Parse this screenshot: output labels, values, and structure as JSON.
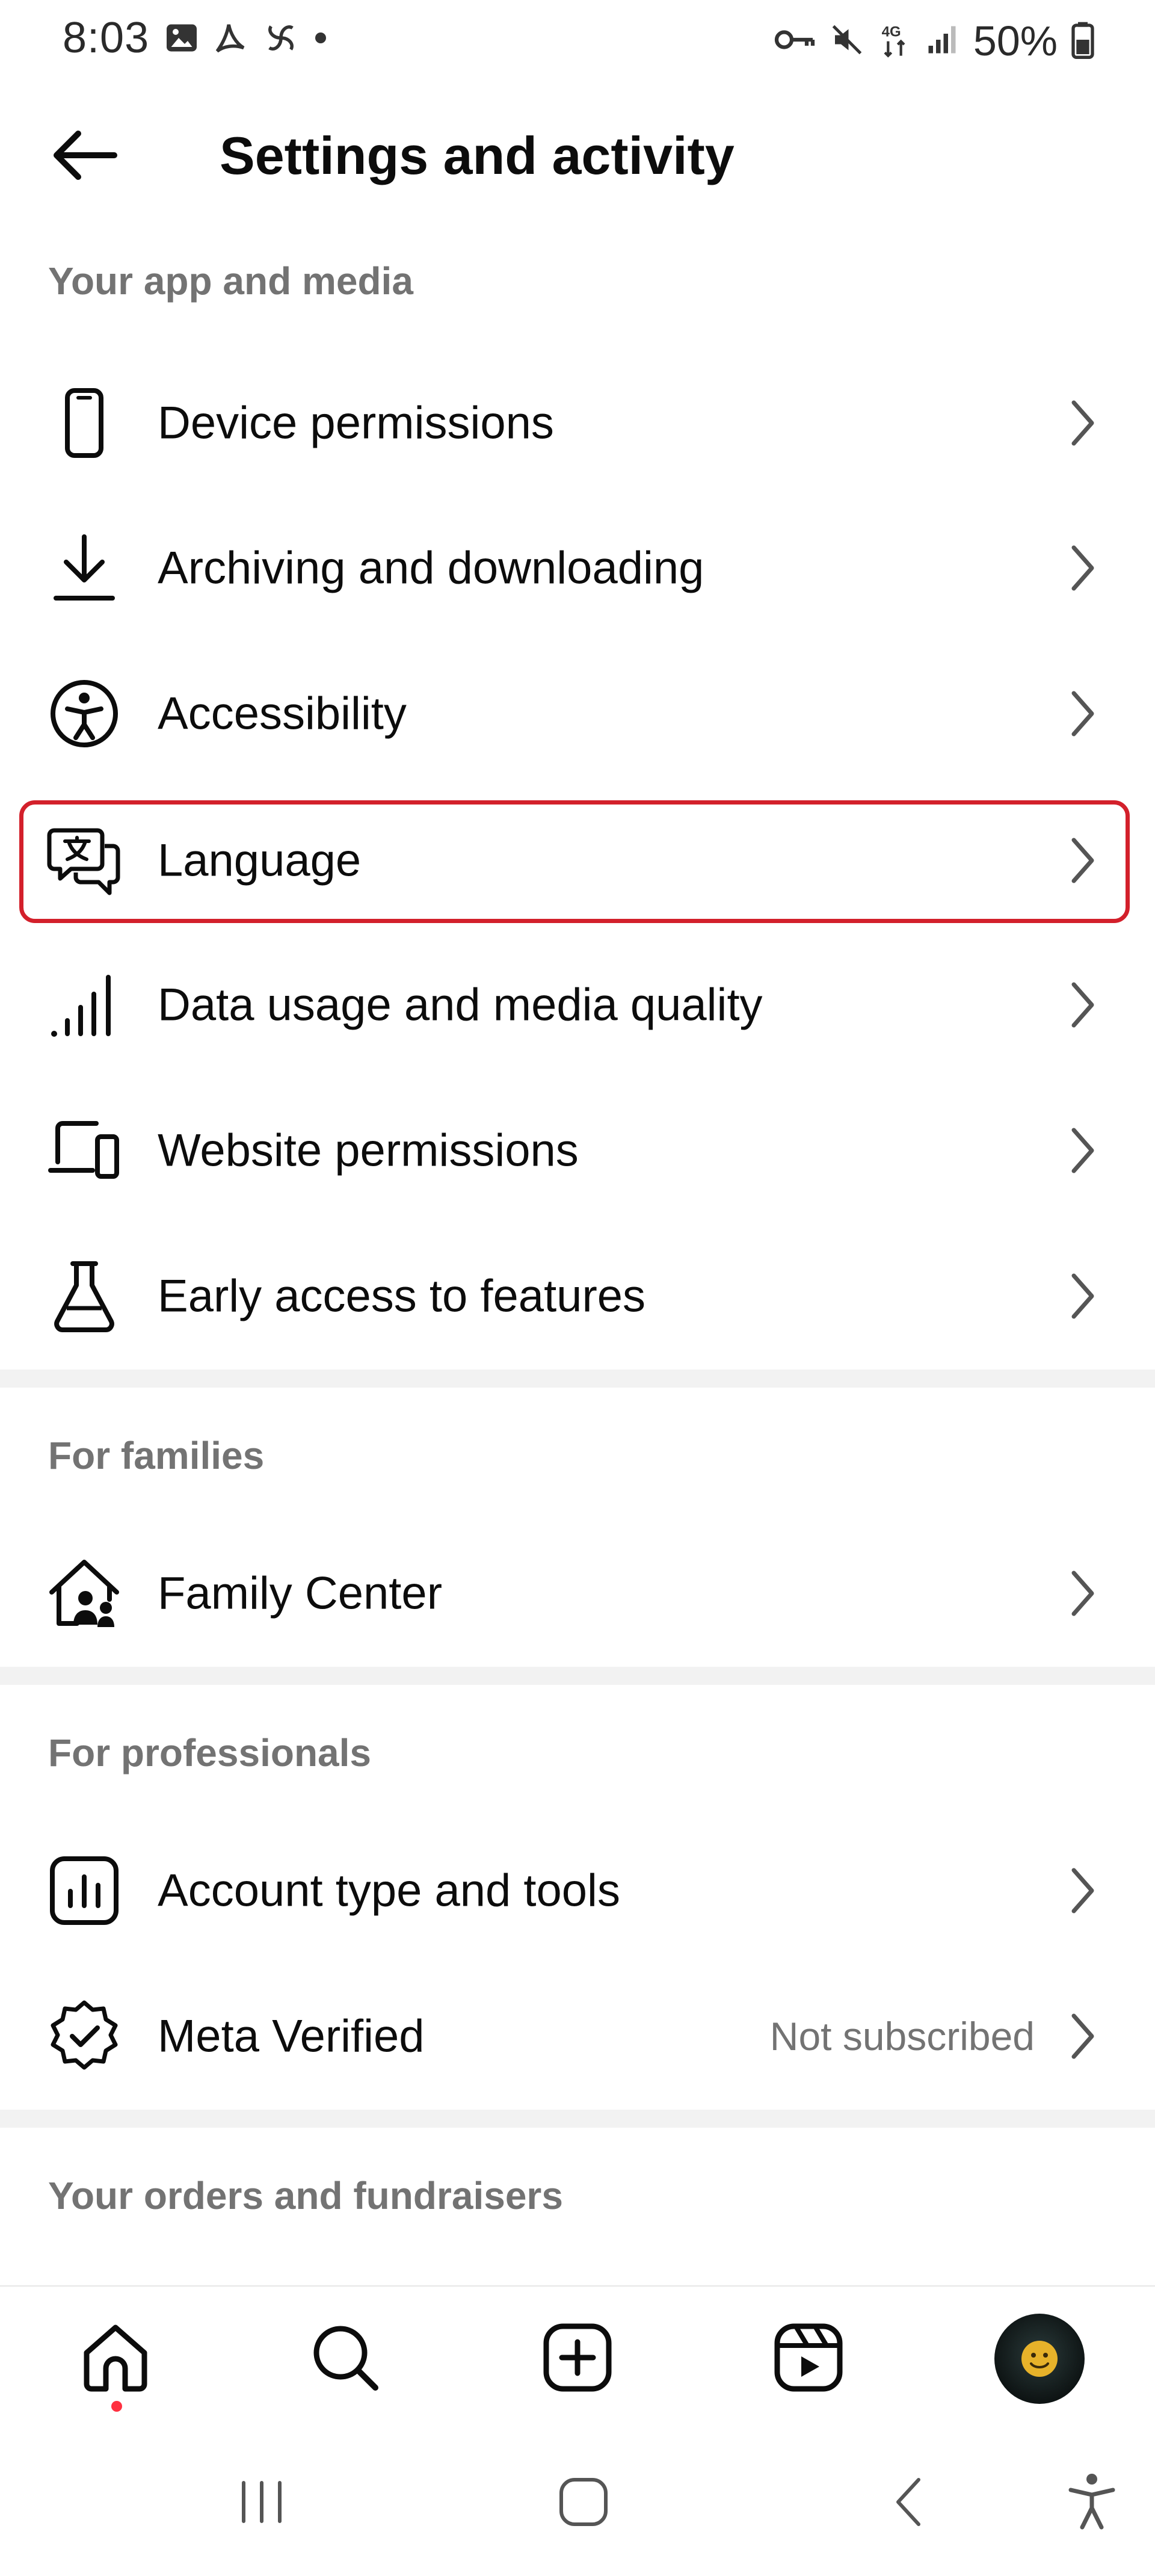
{
  "status_bar": {
    "time": "8:03",
    "battery": "50%",
    "network": "4G"
  },
  "header": {
    "title": "Settings and activity"
  },
  "sections": [
    {
      "title": "Your app and media",
      "items": [
        {
          "label": "Device permissions",
          "icon": "phone-icon"
        },
        {
          "label": "Archiving and downloading",
          "icon": "download-icon"
        },
        {
          "label": "Accessibility",
          "icon": "accessibility-icon"
        },
        {
          "label": "Language",
          "icon": "language-icon",
          "highlighted": true
        },
        {
          "label": "Data usage and media quality",
          "icon": "signal-bars-icon"
        },
        {
          "label": "Website permissions",
          "icon": "laptop-phone-icon"
        },
        {
          "label": "Early access to features",
          "icon": "flask-icon"
        }
      ]
    },
    {
      "title": "For families",
      "items": [
        {
          "label": "Family Center",
          "icon": "family-home-icon"
        }
      ]
    },
    {
      "title": "For professionals",
      "items": [
        {
          "label": "Account type and tools",
          "icon": "bar-chart-icon"
        },
        {
          "label": "Meta Verified",
          "icon": "verified-badge-icon",
          "status": "Not subscribed"
        }
      ]
    },
    {
      "title": "Your orders and fundraisers",
      "items": []
    }
  ],
  "colors": {
    "highlight": "#d3202b",
    "section_title": "#737373",
    "notification_dot": "#ff3040"
  },
  "bottom_nav": [
    "home-icon",
    "search-icon",
    "create-icon",
    "reels-icon",
    "profile-avatar"
  ],
  "system_nav": [
    "recents-icon",
    "home-button-icon",
    "back-icon",
    "accessibility-shortcut-icon"
  ]
}
